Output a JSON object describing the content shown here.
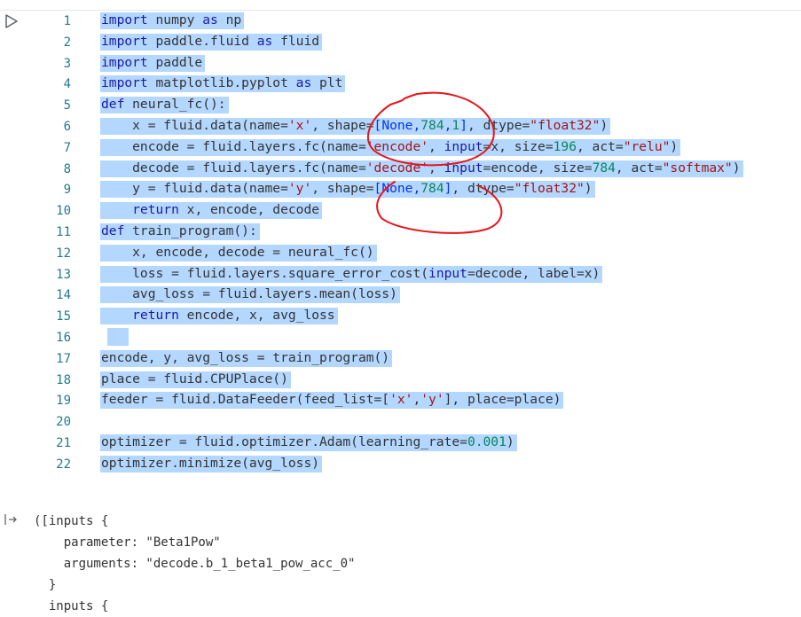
{
  "cell": {
    "run_icon": "play-icon",
    "lines": [
      {
        "n": "1",
        "tokens": [
          {
            "t": "import",
            "c": "kw"
          },
          {
            "t": " numpy "
          },
          {
            "t": "as",
            "c": "kw"
          },
          {
            "t": " np"
          }
        ]
      },
      {
        "n": "2",
        "tokens": [
          {
            "t": "import",
            "c": "kw"
          },
          {
            "t": " paddle.fluid "
          },
          {
            "t": "as",
            "c": "kw"
          },
          {
            "t": " fluid"
          }
        ]
      },
      {
        "n": "3",
        "tokens": [
          {
            "t": "import",
            "c": "kw"
          },
          {
            "t": " paddle"
          }
        ]
      },
      {
        "n": "4",
        "tokens": [
          {
            "t": "import",
            "c": "kw"
          },
          {
            "t": " matplotlib.pyplot "
          },
          {
            "t": "as",
            "c": "kw"
          },
          {
            "t": " plt"
          }
        ]
      },
      {
        "n": "5",
        "tokens": [
          {
            "t": "def",
            "c": "kw"
          },
          {
            "t": " neural_fc():"
          }
        ]
      },
      {
        "n": "6",
        "tokens": [
          {
            "t": "    x = fluid.data(name="
          },
          {
            "t": "'x'",
            "c": "str"
          },
          {
            "t": ", shape="
          },
          {
            "t": "[None,",
            "c": "br"
          },
          {
            "t": "784",
            "c": "num"
          },
          {
            "t": ",",
            "c": "br"
          },
          {
            "t": "1",
            "c": "num"
          },
          {
            "t": "]",
            "c": "br"
          },
          {
            "t": ", dtype="
          },
          {
            "t": "\"float32\"",
            "c": "str"
          },
          {
            "t": ")"
          }
        ]
      },
      {
        "n": "7",
        "tokens": [
          {
            "t": "    encode = fluid.layers.fc(name="
          },
          {
            "t": "'encode'",
            "c": "str"
          },
          {
            "t": ", "
          },
          {
            "t": "input",
            "c": "kw"
          },
          {
            "t": "=x, size="
          },
          {
            "t": "196",
            "c": "num"
          },
          {
            "t": ", act="
          },
          {
            "t": "\"relu\"",
            "c": "str"
          },
          {
            "t": ")"
          }
        ]
      },
      {
        "n": "8",
        "tokens": [
          {
            "t": "    decode = fluid.layers.fc(name="
          },
          {
            "t": "'decode'",
            "c": "str"
          },
          {
            "t": ", "
          },
          {
            "t": "input",
            "c": "kw"
          },
          {
            "t": "=encode, size="
          },
          {
            "t": "784",
            "c": "num"
          },
          {
            "t": ", act="
          },
          {
            "t": "\"softmax\"",
            "c": "str"
          },
          {
            "t": ")"
          }
        ]
      },
      {
        "n": "9",
        "tokens": [
          {
            "t": "    y = fluid.data(name="
          },
          {
            "t": "'y'",
            "c": "str"
          },
          {
            "t": ", shape="
          },
          {
            "t": "[None,",
            "c": "br"
          },
          {
            "t": "784",
            "c": "num"
          },
          {
            "t": "]",
            "c": "br"
          },
          {
            "t": ", dtype="
          },
          {
            "t": "\"float32\"",
            "c": "str"
          },
          {
            "t": ")"
          }
        ]
      },
      {
        "n": "10",
        "tokens": [
          {
            "t": "    "
          },
          {
            "t": "return",
            "c": "kw"
          },
          {
            "t": " x, encode, decode"
          }
        ]
      },
      {
        "n": "11",
        "tokens": [
          {
            "t": "def",
            "c": "kw"
          },
          {
            "t": " train_program():"
          }
        ]
      },
      {
        "n": "12",
        "tokens": [
          {
            "t": "    x, encode, decode = neural_fc()"
          }
        ]
      },
      {
        "n": "13",
        "tokens": [
          {
            "t": "    loss = fluid.layers.square_error_cost("
          },
          {
            "t": "input",
            "c": "kw"
          },
          {
            "t": "=decode, label=x)"
          }
        ]
      },
      {
        "n": "14",
        "tokens": [
          {
            "t": "    avg_loss = fluid.layers.mean(loss)"
          }
        ]
      },
      {
        "n": "15",
        "tokens": [
          {
            "t": "    "
          },
          {
            "t": "return",
            "c": "kw"
          },
          {
            "t": " encode, x, avg_loss"
          }
        ]
      },
      {
        "n": "16",
        "tokens": [],
        "blank": true
      },
      {
        "n": "17",
        "tokens": [
          {
            "t": "encode, y, avg_loss = train_program()"
          }
        ]
      },
      {
        "n": "18",
        "tokens": [
          {
            "t": "place = fluid.CPUPlace()"
          }
        ]
      },
      {
        "n": "19",
        "tokens": [
          {
            "t": "feeder = fluid.DataFeeder(feed_list=["
          },
          {
            "t": "'x'",
            "c": "str"
          },
          {
            "t": ","
          },
          {
            "t": "'y'",
            "c": "str"
          },
          {
            "t": "], place=place)"
          }
        ]
      },
      {
        "n": "20",
        "tokens": []
      },
      {
        "n": "21",
        "tokens": [
          {
            "t": "optimizer = fluid.optimizer.Adam(learning_rate="
          },
          {
            "t": "0.001",
            "c": "num"
          },
          {
            "t": ")"
          }
        ]
      },
      {
        "n": "22",
        "tokens": [
          {
            "t": "optimizer.minimize(avg_loss)"
          }
        ]
      }
    ]
  },
  "output": {
    "icon": "output-arrow-icon",
    "lines": [
      "([inputs {",
      "    parameter: \"Beta1Pow\"",
      "    arguments: \"decode.b_1_beta1_pow_acc_0\"",
      "  }",
      "  inputs {"
    ]
  },
  "annotation": {
    "color": "#e8141b",
    "icon": "red-hand-drawn-circle"
  }
}
